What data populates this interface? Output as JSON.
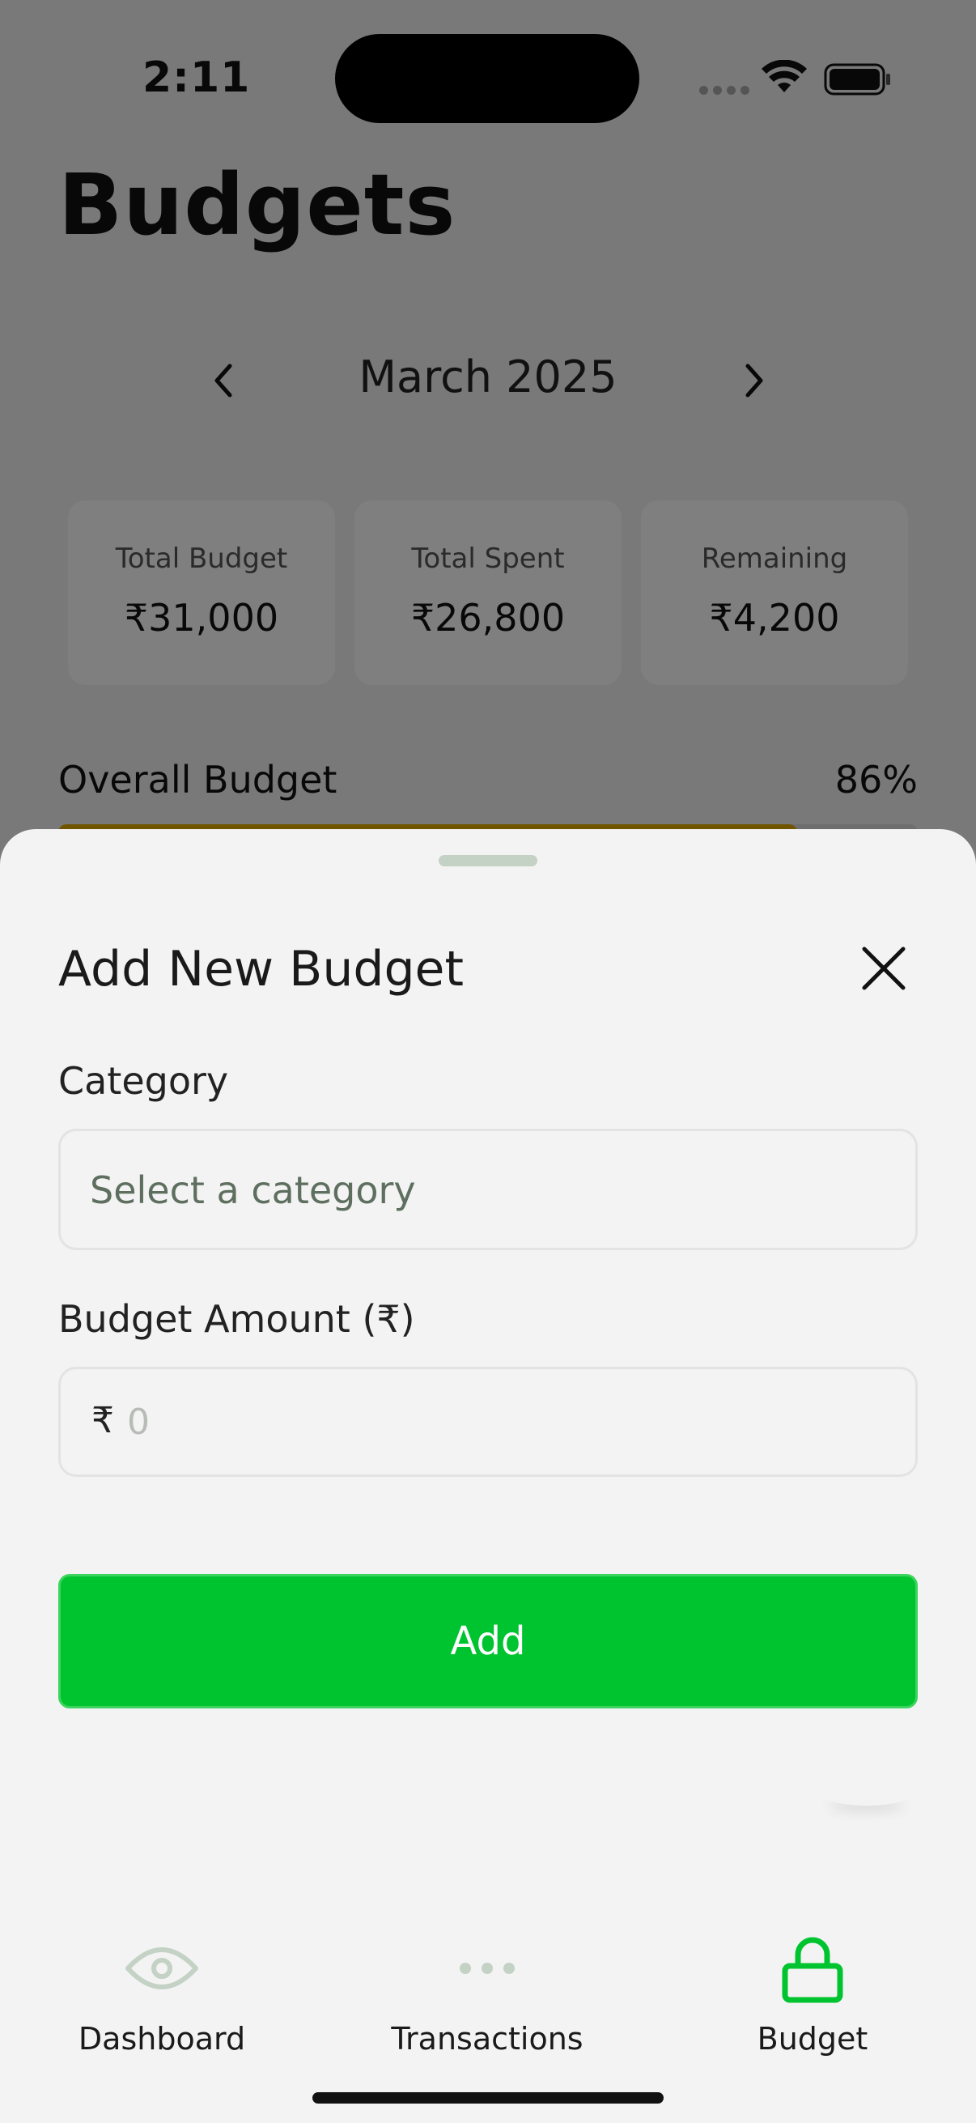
{
  "status_bar": {
    "time": "2:11"
  },
  "page": {
    "title": "Budgets",
    "month": "March 2025",
    "summary": [
      {
        "label": "Total Budget",
        "value": "₹31,000"
      },
      {
        "label": "Total Spent",
        "value": "₹26,800"
      },
      {
        "label": "Remaining",
        "value": "₹4,200"
      }
    ],
    "overall": {
      "label": "Overall Budget",
      "percent": "86%",
      "fill_fraction": 0.86
    }
  },
  "sheet": {
    "title": "Add New Budget",
    "category_label": "Category",
    "category_placeholder": "Select a category",
    "amount_label": "Budget Amount (₹)",
    "currency_prefix": "₹",
    "amount_placeholder": "0",
    "add_label": "Add"
  },
  "tabs": [
    {
      "label": "Dashboard",
      "icon": "eye-icon",
      "active": false
    },
    {
      "label": "Transactions",
      "icon": "ellipsis-icon",
      "active": false
    },
    {
      "label": "Budget",
      "icon": "lock-icon",
      "active": true
    }
  ],
  "colors": {
    "accent": "#00c42f",
    "inactive_icon": "#c3d2c4",
    "overall_bar": "#e0a800"
  }
}
